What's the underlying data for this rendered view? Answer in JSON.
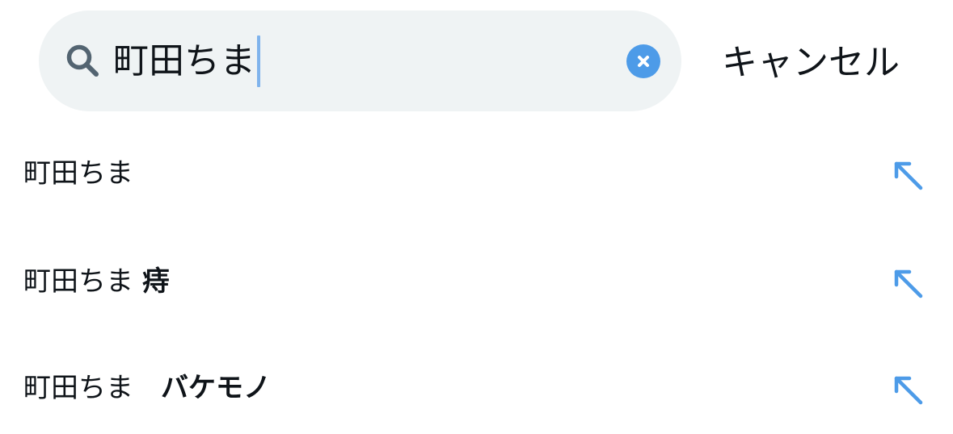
{
  "search": {
    "value": "町田ちま",
    "clear_icon": "clear-circle-icon",
    "search_icon": "magnifier-icon"
  },
  "header": {
    "cancel_label": "キャンセル"
  },
  "suggestions": [
    {
      "prefix": "町田ちま",
      "suffix": "",
      "icon": "arrow-up-left-icon"
    },
    {
      "prefix": "町田ちま ",
      "suffix": "痔",
      "icon": "arrow-up-left-icon"
    },
    {
      "prefix": "町田ちま　",
      "suffix": "バケモノ",
      "icon": "arrow-up-left-icon"
    }
  ],
  "colors": {
    "accent": "#4d9be8",
    "caret": "#7fb3ec",
    "search_bg": "#eff3f4",
    "text": "#0f1419",
    "icon_gray": "#536471"
  }
}
